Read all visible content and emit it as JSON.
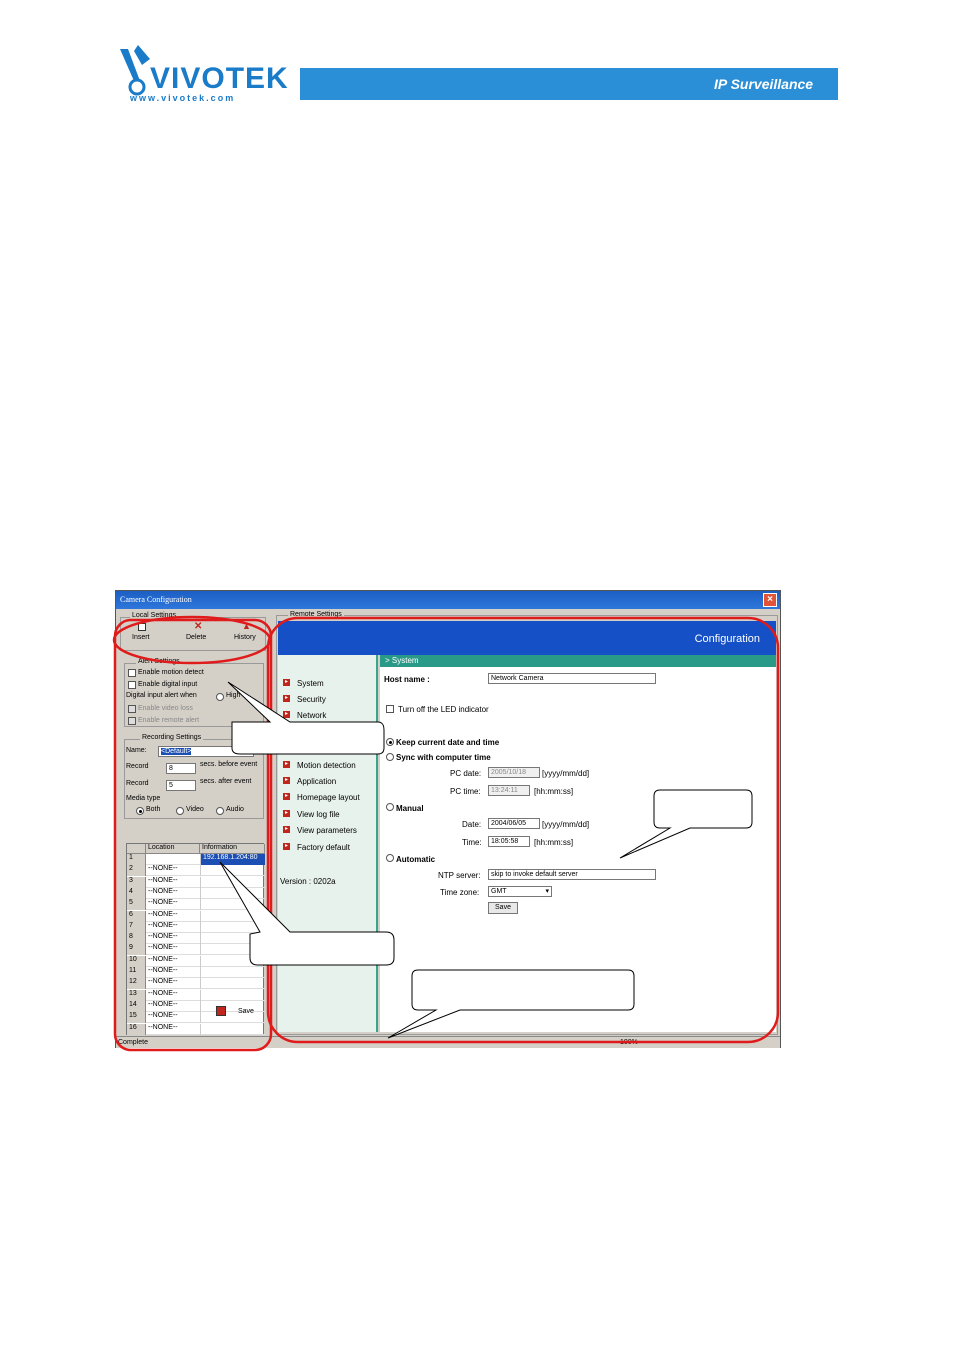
{
  "brand": {
    "logo": "VIVOTEK",
    "url": "www.vivotek.com",
    "tagline": "IP Surveillance"
  },
  "window": {
    "title": "Camera Configuration",
    "close": "×",
    "local_settings": {
      "title": "Local Settings",
      "insert": "Insert",
      "delete": "Delete",
      "history": "History"
    },
    "alert_settings": {
      "title": "Alert Settings",
      "motion": "Enable motion detect",
      "digital": "Enable digital input",
      "digital_when": "Digital input alert when",
      "digital_opt": "High",
      "video_loss": "Enable video loss",
      "remote_alert": "Enable remote alert"
    },
    "recording": {
      "title": "Recording Settings",
      "name_label": "Name:",
      "name_value": "<Default>",
      "record1_label": "Record",
      "record1_value": "8",
      "record1_suffix": "secs. before event",
      "record2_label": "Record",
      "record2_value": "5",
      "record2_suffix": "secs. after event",
      "media_label": "Media type",
      "media_both": "Both",
      "media_video": "Video",
      "media_audio": "Audio"
    },
    "table": {
      "col_location": "Location",
      "col_info": "Information",
      "rows": [
        {
          "n": "1",
          "loc": "",
          "info": "192.168.1.204:80"
        },
        {
          "n": "2",
          "loc": "--NONE--",
          "info": ""
        },
        {
          "n": "3",
          "loc": "--NONE--",
          "info": ""
        },
        {
          "n": "4",
          "loc": "--NONE--",
          "info": ""
        },
        {
          "n": "5",
          "loc": "--NONE--",
          "info": ""
        },
        {
          "n": "6",
          "loc": "--NONE--",
          "info": ""
        },
        {
          "n": "7",
          "loc": "--NONE--",
          "info": ""
        },
        {
          "n": "8",
          "loc": "--NONE--",
          "info": ""
        },
        {
          "n": "9",
          "loc": "--NONE--",
          "info": ""
        },
        {
          "n": "10",
          "loc": "--NONE--",
          "info": ""
        },
        {
          "n": "11",
          "loc": "--NONE--",
          "info": ""
        },
        {
          "n": "12",
          "loc": "--NONE--",
          "info": ""
        },
        {
          "n": "13",
          "loc": "--NONE--",
          "info": ""
        },
        {
          "n": "14",
          "loc": "--NONE--",
          "info": ""
        },
        {
          "n": "15",
          "loc": "--NONE--",
          "info": ""
        },
        {
          "n": "16",
          "loc": "--NONE--",
          "info": ""
        }
      ]
    },
    "save": "Save",
    "remote_settings": "Remote Settings",
    "configuration": "Configuration",
    "nav": [
      {
        "label": "System"
      },
      {
        "label": "Security"
      },
      {
        "label": "Network"
      },
      {
        "label": "Video"
      },
      {
        "label": "Motion detection"
      },
      {
        "label": "Application"
      },
      {
        "label": "Homepage layout"
      },
      {
        "label": "View log file"
      },
      {
        "label": "View parameters"
      },
      {
        "label": "Factory default"
      }
    ],
    "version": "Version : 0202a",
    "system": {
      "heading": "> System",
      "host_label": "Host name :",
      "host_value": "Network Camera",
      "led": "Turn off the LED indicator",
      "keep": "Keep current date and time",
      "sync": "Sync with computer time",
      "pc_date_label": "PC date:",
      "pc_date": "2005/10/18",
      "pc_date_fmt": "[yyyy/mm/dd]",
      "pc_time_label": "PC time:",
      "pc_time": "13:24:11",
      "pc_time_fmt": "[hh:mm:ss]",
      "manual": "Manual",
      "date_label": "Date:",
      "date": "2004/06/05",
      "date_fmt": "[yyyy/mm/dd]",
      "time_label": "Time:",
      "time": "18:05:58",
      "time_fmt": "[hh:mm:ss]",
      "automatic": "Automatic",
      "ntp_label": "NTP server:",
      "ntp_value": "skip to invoke default server",
      "tz_label": "Time zone:",
      "tz_value": "GMT",
      "save": "Save"
    },
    "status": "Complete",
    "zoom": "100%"
  },
  "colors": {
    "annotation": "#e01b1b",
    "brand": "#1a7bc8",
    "config_bar": "#1650c6",
    "section": "#2a9a88"
  }
}
